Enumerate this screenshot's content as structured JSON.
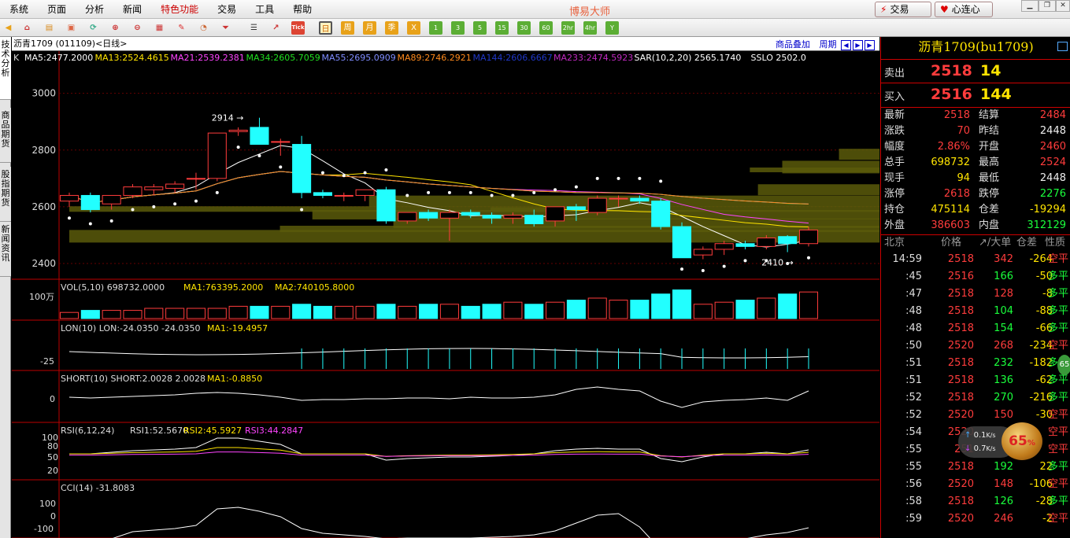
{
  "menu": {
    "items": [
      "系统",
      "页面",
      "分析",
      "新闻",
      "特色功能",
      "交易",
      "工具",
      "帮助"
    ],
    "highlight_index": 4
  },
  "app_title": "博易大师",
  "top_buttons": {
    "trade": "交易",
    "heart": "心连心"
  },
  "toolbar": {
    "tick": "Tick",
    "periods": [
      "日",
      "周",
      "月",
      "季",
      "X",
      "1",
      "3",
      "5",
      "15",
      "30",
      "60",
      "2hr",
      "4hr",
      "Y"
    ]
  },
  "side_tabs": [
    "技术分析",
    "商品期货",
    "股指期货",
    "新闻资讯"
  ],
  "chart": {
    "title": "沥青1709 (011109)<日线>",
    "right_links": [
      "商品叠加",
      "周期"
    ],
    "ma_prefix": "K",
    "ma_items": [
      {
        "label": "MA5:2477.2000",
        "color": "#ffffff"
      },
      {
        "label": "MA13:2524.4615",
        "color": "#ffe400"
      },
      {
        "label": "MA21:2539.2381",
        "color": "#ff44ff"
      },
      {
        "label": "MA34:2605.7059",
        "color": "#20e020"
      },
      {
        "label": "MA55:2695.0909",
        "color": "#7f8cff"
      },
      {
        "label": "MA89:2746.2921",
        "color": "#ff8a1c"
      },
      {
        "label": "MA144:2606.6667",
        "color": "#2038c8"
      },
      {
        "label": "MA233:2474.5923",
        "color": "#c02ac0"
      },
      {
        "label": "SAR(10,2,20) 2565.1740",
        "color": "#ffffff"
      },
      {
        "label": "SSLO 2502.0",
        "color": "#ffffff"
      }
    ],
    "price_axis": [
      "3000",
      "2800",
      "2600",
      "2400"
    ],
    "annotations": {
      "high": "2914",
      "low": "2410"
    },
    "vol": {
      "label": "VOL(5,10) 698732.0000",
      "ma1": "MA1:763395.2000",
      "ma2": "MA2:740105.8000",
      "axis": "100万"
    },
    "lon": {
      "label": "LON(10) LON:-24.0350 -24.0350",
      "ma1": "MA1:-19.4957",
      "axis": "-25"
    },
    "short": {
      "label": "SHORT(10) SHORT:2.0028 2.0028",
      "ma1": "MA1:-0.8850",
      "axis": "0"
    },
    "rsi": {
      "label": "RSI(6,12,24)",
      "r1": "RSI1:52.5670",
      "r2": "RSI2:45.5927",
      "r3": "RSI3:44.2847",
      "axis": [
        "100",
        "80",
        "50",
        "20"
      ]
    },
    "cci": {
      "label": "CCI(14) -31.8083",
      "axis": [
        "100",
        "0",
        "-100"
      ]
    },
    "chart_data": {
      "type": "candlestick",
      "ylim": [
        2350,
        3110
      ],
      "candles": [
        {
          "o": 2620,
          "h": 2650,
          "l": 2600,
          "c": 2640
        },
        {
          "o": 2640,
          "h": 2650,
          "l": 2580,
          "c": 2590
        },
        {
          "o": 2610,
          "h": 2640,
          "l": 2590,
          "c": 2640
        },
        {
          "o": 2640,
          "h": 2680,
          "l": 2630,
          "c": 2670
        },
        {
          "o": 2660,
          "h": 2680,
          "l": 2640,
          "c": 2670
        },
        {
          "o": 2665,
          "h": 2690,
          "l": 2650,
          "c": 2680
        },
        {
          "o": 2700,
          "h": 2720,
          "l": 2660,
          "c": 2700
        },
        {
          "o": 2700,
          "h": 2860,
          "l": 2690,
          "c": 2860
        },
        {
          "o": 2865,
          "h": 2880,
          "l": 2850,
          "c": 2870
        },
        {
          "o": 2880,
          "h": 2914,
          "l": 2820,
          "c": 2820
        },
        {
          "o": 2830,
          "h": 2840,
          "l": 2780,
          "c": 2830
        },
        {
          "o": 2820,
          "h": 2850,
          "l": 2630,
          "c": 2650
        },
        {
          "o": 2650,
          "h": 2660,
          "l": 2630,
          "c": 2640
        },
        {
          "o": 2640,
          "h": 2650,
          "l": 2620,
          "c": 2640
        },
        {
          "o": 2640,
          "h": 2660,
          "l": 2620,
          "c": 2660
        },
        {
          "o": 2660,
          "h": 2670,
          "l": 2540,
          "c": 2550
        },
        {
          "o": 2550,
          "h": 2580,
          "l": 2540,
          "c": 2580
        },
        {
          "o": 2580,
          "h": 2590,
          "l": 2550,
          "c": 2560
        },
        {
          "o": 2560,
          "h": 2590,
          "l": 2480,
          "c": 2580
        },
        {
          "o": 2580,
          "h": 2590,
          "l": 2560,
          "c": 2570
        },
        {
          "o": 2570,
          "h": 2580,
          "l": 2540,
          "c": 2560
        },
        {
          "o": 2560,
          "h": 2580,
          "l": 2540,
          "c": 2570
        },
        {
          "o": 2570,
          "h": 2590,
          "l": 2530,
          "c": 2540
        },
        {
          "o": 2550,
          "h": 2600,
          "l": 2530,
          "c": 2600
        },
        {
          "o": 2600,
          "h": 2610,
          "l": 2550,
          "c": 2590
        },
        {
          "o": 2580,
          "h": 2640,
          "l": 2570,
          "c": 2630
        },
        {
          "o": 2630,
          "h": 2640,
          "l": 2600,
          "c": 2630
        },
        {
          "o": 2630,
          "h": 2640,
          "l": 2610,
          "c": 2620
        },
        {
          "o": 2620,
          "h": 2630,
          "l": 2520,
          "c": 2530
        },
        {
          "o": 2530,
          "h": 2545,
          "l": 2420,
          "c": 2420
        },
        {
          "o": 2430,
          "h": 2460,
          "l": 2415,
          "c": 2450
        },
        {
          "o": 2450,
          "h": 2480,
          "l": 2430,
          "c": 2470
        },
        {
          "o": 2470,
          "h": 2480,
          "l": 2450,
          "c": 2460
        },
        {
          "o": 2460,
          "h": 2500,
          "l": 2450,
          "c": 2490
        },
        {
          "o": 2495,
          "h": 2500,
          "l": 2440,
          "c": 2470
        },
        {
          "o": 2470,
          "h": 2530,
          "l": 2460,
          "c": 2518
        }
      ]
    }
  },
  "quote": {
    "title": "沥青1709(bu1709)",
    "sell": {
      "label": "卖出",
      "price": "2518",
      "vol": "14"
    },
    "buy": {
      "label": "买入",
      "price": "2516",
      "vol": "144"
    },
    "stats": [
      {
        "k1": "最新",
        "v1": "2518",
        "c1": "red",
        "k2": "结算",
        "v2": "2484",
        "c2": "red"
      },
      {
        "k1": "涨跌",
        "v1": "70",
        "c1": "red",
        "k2": "昨结",
        "v2": "2448",
        "c2": "wht"
      },
      {
        "k1": "幅度",
        "v1": "2.86%",
        "c1": "red",
        "k2": "开盘",
        "v2": "2460",
        "c2": "red"
      },
      {
        "k1": "总手",
        "v1": "698732",
        "c1": "yel",
        "k2": "最高",
        "v2": "2524",
        "c2": "red"
      },
      {
        "k1": "现手",
        "v1": "94",
        "c1": "yel",
        "k2": "最低",
        "v2": "2448",
        "c2": "wht"
      },
      {
        "k1": "涨停",
        "v1": "2618",
        "c1": "red",
        "k2": "跌停",
        "v2": "2276",
        "c2": "grn"
      },
      {
        "k1": "持仓",
        "v1": "475114",
        "c1": "yel",
        "k2": "仓差",
        "v2": "-19294",
        "c2": "yel"
      },
      {
        "k1": "外盘",
        "v1": "386603",
        "c1": "red",
        "k2": "内盘",
        "v2": "312129",
        "c2": "grn"
      }
    ],
    "tick_header": {
      "city": "北京",
      "price": "价格",
      "big": "↗/大单",
      "diff": "仓差",
      "nature": "性质"
    },
    "ticks": [
      {
        "t": "14:59",
        "p": "2518",
        "v": "342",
        "vc": "red",
        "d": "-264",
        "n": "空平",
        "nc": "red"
      },
      {
        "t": ":45",
        "p": "2516",
        "v": "166",
        "vc": "grn",
        "d": "-50",
        "n": "多平",
        "nc": "grn"
      },
      {
        "t": ":47",
        "p": "2518",
        "v": "128",
        "vc": "red",
        "d": "-8",
        "n": "多平",
        "nc": "grn"
      },
      {
        "t": ":48",
        "p": "2518",
        "v": "104",
        "vc": "grn",
        "d": "-88",
        "n": "多平",
        "nc": "grn"
      },
      {
        "t": ":48",
        "p": "2518",
        "v": "154",
        "vc": "grn",
        "d": "-66",
        "n": "多平",
        "nc": "grn"
      },
      {
        "t": ":50",
        "p": "2520",
        "v": "268",
        "vc": "red",
        "d": "-234",
        "n": "空平",
        "nc": "red"
      },
      {
        "t": ":51",
        "p": "2518",
        "v": "232",
        "vc": "grn",
        "d": "-182",
        "n": "多平",
        "nc": "grn"
      },
      {
        "t": ":51",
        "p": "2518",
        "v": "136",
        "vc": "grn",
        "d": "-62",
        "n": "多平",
        "nc": "grn"
      },
      {
        "t": ":52",
        "p": "2518",
        "v": "270",
        "vc": "grn",
        "d": "-216",
        "n": "多平",
        "nc": "grn"
      },
      {
        "t": ":52",
        "p": "2520",
        "v": "150",
        "vc": "red",
        "d": "-30",
        "n": "空平",
        "nc": "red"
      },
      {
        "t": ":54",
        "p": "2520",
        "v": "",
        "vc": "red",
        "d": "",
        "n": "空平",
        "nc": "red"
      },
      {
        "t": ":55",
        "p": "251",
        "v": "",
        "vc": "red",
        "d": "",
        "n": "空平",
        "nc": "red"
      },
      {
        "t": ":55",
        "p": "2518",
        "v": "192",
        "vc": "grn",
        "d": "22",
        "n": "多平",
        "nc": "grn"
      },
      {
        "t": ":56",
        "p": "2520",
        "v": "148",
        "vc": "red",
        "d": "-106",
        "n": "空平",
        "nc": "red"
      },
      {
        "t": ":58",
        "p": "2518",
        "v": "126",
        "vc": "grn",
        "d": "-28",
        "n": "多平",
        "nc": "grn"
      },
      {
        "t": ":59",
        "p": "2520",
        "v": "246",
        "vc": "red",
        "d": "-2",
        "n": "空平",
        "nc": "red"
      }
    ]
  },
  "speed": {
    "up": "0.1",
    "down": "0.7",
    "unit": "K/s",
    "pct": "65"
  },
  "green_ball": "65"
}
